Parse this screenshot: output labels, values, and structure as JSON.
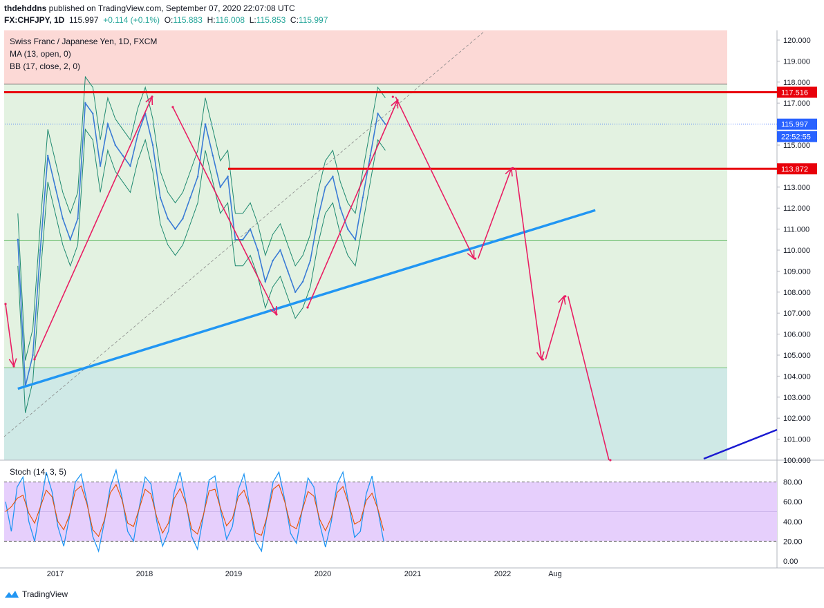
{
  "header": {
    "author": "thdehddns",
    "published": "published on TradingView.com, September 07, 2020 22:07:08 UTC",
    "symbol": "FX:CHFJPY, 1D",
    "price": "115.997",
    "change": "+0.114 (+0.1%)",
    "o_label": "O:",
    "o": "115.883",
    "h_label": "H:",
    "h": "116.008",
    "l_label": "L:",
    "l": "115.853",
    "c_label": "C:",
    "c": "115.997"
  },
  "legend": {
    "title": "Swiss Franc / Japanese Yen, 1D, FXCM",
    "ma": "MA (13, open, 0)",
    "bb": "BB (17, close, 2, 0)",
    "stoch": "Stoch (14, 3, 5)"
  },
  "footer": {
    "brand": "TradingView"
  },
  "colors": {
    "price_line": "#3a7bd5",
    "bb_line": "#1f8a70",
    "resistance": "#e8000b",
    "trendline": "#2196f3",
    "arrows": "#e91e63",
    "zone_top": "#fcd9d6",
    "zone_mid": "#e3f2e1",
    "zone_bottom": "#cfe9e6",
    "stoch_band": "#e6cffc"
  },
  "chart_data": [
    {
      "type": "line",
      "title": "Swiss Franc / Japanese Yen, 1D, FXCM",
      "y_axis": {
        "range": [
          100,
          120
        ],
        "ticks": [
          "120.000",
          "119.000",
          "118.000",
          "117.000",
          "116.000",
          "115.000",
          "113.000",
          "112.000",
          "111.000",
          "110.000",
          "109.000",
          "108.000",
          "107.000",
          "106.000",
          "105.000",
          "104.000",
          "103.000",
          "102.000",
          "101.000",
          "100.000"
        ]
      },
      "x_axis": {
        "ticks": [
          "2017",
          "2018",
          "2019",
          "2020",
          "2021",
          "2022",
          "Aug"
        ]
      },
      "price_labels": {
        "resistance_high": "117.516",
        "last_price": "115.997",
        "countdown": "22:52:55",
        "resistance_low": "113.872"
      },
      "series": [
        {
          "name": "CHFJPY close",
          "points": [
            [
              "2016-08",
              110.5
            ],
            [
              "2016-09",
              103.5
            ],
            [
              "2016-10",
              105.0
            ],
            [
              "2016-11",
              110.0
            ],
            [
              "2016-12",
              114.5
            ],
            [
              "2017-01",
              113.0
            ],
            [
              "2017-02",
              111.5
            ],
            [
              "2017-03",
              110.5
            ],
            [
              "2017-04",
              111.5
            ],
            [
              "2017-05",
              117.0
            ],
            [
              "2017-06",
              116.5
            ],
            [
              "2017-07",
              114.0
            ],
            [
              "2017-08",
              116.0
            ],
            [
              "2017-09",
              115.0
            ],
            [
              "2017-10",
              114.5
            ],
            [
              "2017-11",
              114.0
            ],
            [
              "2017-12",
              115.5
            ],
            [
              "2018-01",
              116.5
            ],
            [
              "2018-02",
              115.0
            ],
            [
              "2018-03",
              112.5
            ],
            [
              "2018-04",
              111.5
            ],
            [
              "2018-05",
              111.0
            ],
            [
              "2018-06",
              111.5
            ],
            [
              "2018-07",
              112.5
            ],
            [
              "2018-08",
              113.5
            ],
            [
              "2018-09",
              116.0
            ],
            [
              "2018-10",
              114.5
            ],
            [
              "2018-11",
              113.0
            ],
            [
              "2018-12",
              113.5
            ],
            [
              "2019-01",
              110.5
            ],
            [
              "2019-02",
              110.5
            ],
            [
              "2019-03",
              111.0
            ],
            [
              "2019-04",
              110.0
            ],
            [
              "2019-05",
              108.5
            ],
            [
              "2019-06",
              109.5
            ],
            [
              "2019-07",
              110.0
            ],
            [
              "2019-08",
              109.0
            ],
            [
              "2019-09",
              108.0
            ],
            [
              "2019-10",
              108.5
            ],
            [
              "2019-11",
              109.5
            ],
            [
              "2019-12",
              111.5
            ],
            [
              "2020-01",
              113.0
            ],
            [
              "2020-02",
              113.5
            ],
            [
              "2020-03",
              112.0
            ],
            [
              "2020-04",
              111.0
            ],
            [
              "2020-05",
              110.5
            ],
            [
              "2020-06",
              112.5
            ],
            [
              "2020-07",
              114.5
            ],
            [
              "2020-08",
              116.5
            ],
            [
              "2020-09",
              116.0
            ]
          ]
        },
        {
          "name": "Projection path",
          "points": [
            [
              "2020-10",
              117.3
            ],
            [
              "2021-09",
              109.6
            ],
            [
              "2022-02",
              113.9
            ],
            [
              "2022-06",
              104.8
            ],
            [
              "2022-09",
              107.8
            ],
            [
              "2023-03",
              100.0
            ]
          ]
        }
      ],
      "levels": [
        117.516,
        113.872
      ],
      "trendline": {
        "from": [
          "2016-08",
          103.4
        ],
        "to": [
          "2023-01",
          111.9
        ]
      }
    },
    {
      "type": "line",
      "title": "Stoch (14, 3, 5)",
      "y_axis": {
        "range": [
          0,
          100
        ],
        "ticks": [
          "80.00",
          "60.00",
          "40.00",
          "20.00",
          "0.00"
        ]
      },
      "bands": [
        20,
        80
      ],
      "series": [
        {
          "name": "%K",
          "values": [
            60,
            30,
            75,
            85,
            40,
            20,
            55,
            90,
            70,
            35,
            15,
            45,
            80,
            88,
            60,
            25,
            10,
            40,
            75,
            92,
            65,
            30,
            20,
            55,
            85,
            78,
            40,
            15,
            30,
            70,
            90,
            60,
            25,
            12,
            45,
            82,
            86,
            50,
            22,
            35,
            72,
            88,
            55,
            20,
            10,
            48,
            80,
            90,
            62,
            28,
            18,
            52,
            84,
            75,
            38,
            14,
            40,
            78,
            90,
            58,
            24,
            30,
            68,
            86,
            52,
            20
          ]
        }
      ]
    }
  ]
}
